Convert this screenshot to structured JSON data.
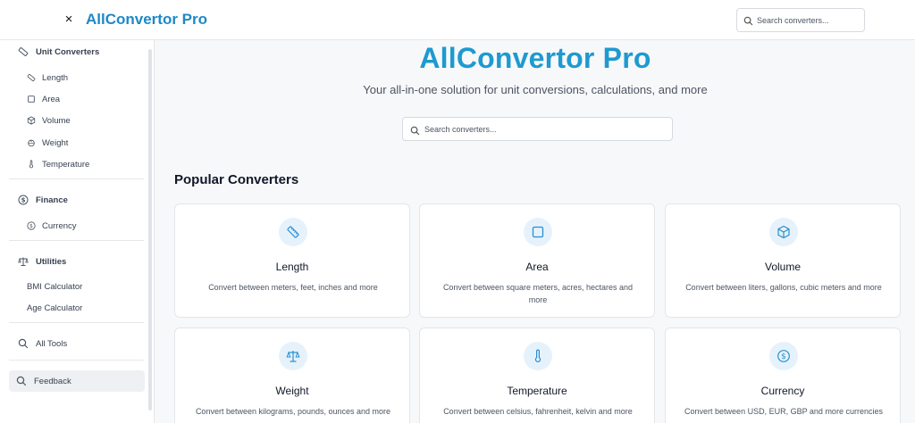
{
  "header": {
    "close_label": "×",
    "brand": "AllConvertor Pro",
    "search_placeholder": "Search converters..."
  },
  "sidebar": {
    "sections": [
      {
        "label": "Unit Converters",
        "icon": "ruler-icon",
        "items": [
          {
            "label": "Length",
            "icon": "ruler-icon"
          },
          {
            "label": "Area",
            "icon": "square-icon"
          },
          {
            "label": "Volume",
            "icon": "cube-icon"
          },
          {
            "label": "Weight",
            "icon": "weight-icon"
          },
          {
            "label": "Temperature",
            "icon": "thermometer-icon"
          }
        ]
      },
      {
        "label": "Finance",
        "icon": "dollar-circle-icon",
        "items": [
          {
            "label": "Currency",
            "icon": "dollar-circle-icon"
          }
        ]
      },
      {
        "label": "Utilities",
        "icon": "scale-icon",
        "items": [
          {
            "label": "BMI Calculator"
          },
          {
            "label": "Age Calculator"
          }
        ]
      }
    ],
    "all_tools": "All Tools",
    "feedback": "Feedback"
  },
  "hero": {
    "title": "AllConvertor Pro",
    "subtitle": "Your all-in-one solution for unit conversions, calculations, and more",
    "search_placeholder": "Search converters..."
  },
  "popular": {
    "title": "Popular Converters",
    "cards": [
      {
        "title": "Length",
        "desc": "Convert between meters, feet, inches and more",
        "icon": "ruler-icon"
      },
      {
        "title": "Area",
        "desc": "Convert between square meters, acres, hectares and more",
        "icon": "square-icon"
      },
      {
        "title": "Volume",
        "desc": "Convert between liters, gallons, cubic meters and more",
        "icon": "cube-icon"
      },
      {
        "title": "Weight",
        "desc": "Convert between kilograms, pounds, ounces and more",
        "icon": "scale-icon"
      },
      {
        "title": "Temperature",
        "desc": "Convert between celsius, fahrenheit, kelvin and more",
        "icon": "thermometer-icon"
      },
      {
        "title": "Currency",
        "desc": "Convert between USD, EUR, GBP and more currencies",
        "icon": "dollar-circle-icon"
      }
    ]
  },
  "colors": {
    "brand": "#1e88c7",
    "hero_title": "#1e9ad0",
    "icon_bg": "#e6f2fb",
    "icon_fg": "#2a8fd0"
  }
}
